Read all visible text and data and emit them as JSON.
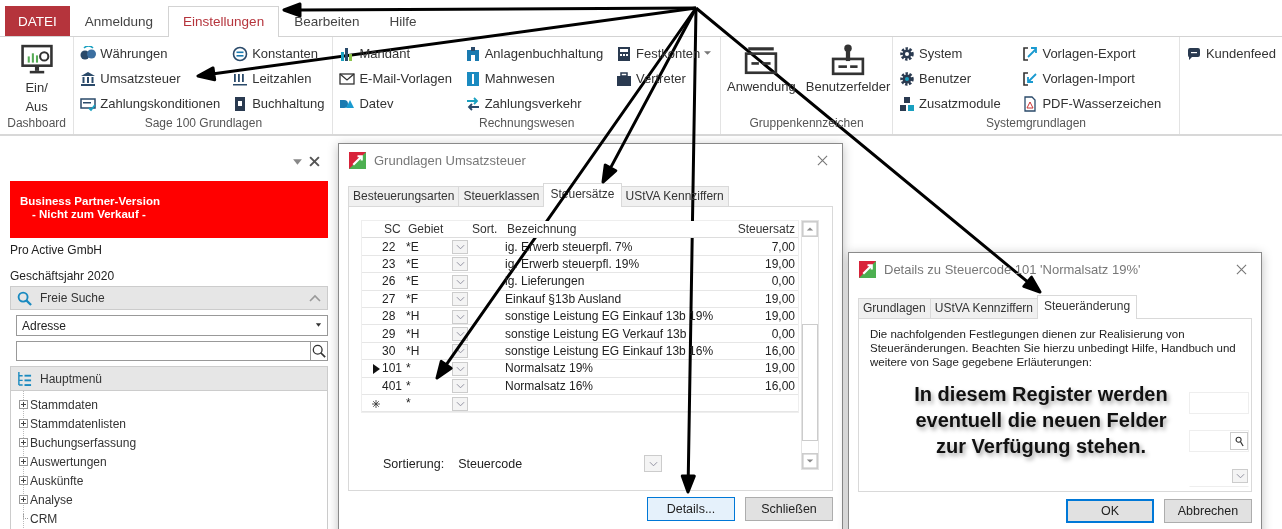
{
  "menu_tabs": [
    {
      "label": "DATEI",
      "kind": "file",
      "selected": false
    },
    {
      "label": "Anmeldung",
      "kind": "tab",
      "selected": false
    },
    {
      "label": "Einstellungen",
      "kind": "tab",
      "selected": true
    },
    {
      "label": "Bearbeiten",
      "kind": "tab",
      "selected": false
    },
    {
      "label": "Hilfe",
      "kind": "tab",
      "selected": false
    }
  ],
  "ribbon_groups": [
    {
      "label": "Dashboard",
      "items": [
        {
          "label": "Ein/ Aus",
          "kind": "large"
        }
      ]
    },
    {
      "label": "Sage 100 Grundlagen",
      "items": [
        {
          "label": "Währungen",
          "kind": "small"
        },
        {
          "label": "Umsatzsteuer",
          "kind": "small"
        },
        {
          "label": "Zahlungskonditionen",
          "kind": "small"
        },
        {
          "label": "Konstanten",
          "kind": "small"
        },
        {
          "label": "Leitzahlen",
          "kind": "small"
        },
        {
          "label": "Buchhaltung",
          "kind": "small"
        }
      ]
    },
    {
      "label": "Rechnungswesen",
      "items": [
        {
          "label": "Mandant",
          "kind": "small"
        },
        {
          "label": "E-Mail-Vorlagen",
          "kind": "small"
        },
        {
          "label": "Datev",
          "kind": "small"
        },
        {
          "label": "Anlagenbuchhaltung",
          "kind": "small"
        },
        {
          "label": "Mahnwesen",
          "kind": "small"
        },
        {
          "label": "Zahlungsverkehr",
          "kind": "small"
        },
        {
          "label": "Festkonten",
          "kind": "menu"
        },
        {
          "label": "Vertreter",
          "kind": "small"
        }
      ]
    },
    {
      "label": "Gruppenkennzeichen",
      "items": [
        {
          "label": "Anwendung",
          "kind": "large"
        },
        {
          "label": "Benutzerfelder",
          "kind": "large"
        }
      ]
    },
    {
      "label": "Systemgrundlagen",
      "items": [
        {
          "label": "System",
          "kind": "small"
        },
        {
          "label": "Benutzer",
          "kind": "small"
        },
        {
          "label": "Zusatzmodule",
          "kind": "small"
        },
        {
          "label": "Vorlagen-Export",
          "kind": "small"
        },
        {
          "label": "Vorlagen-Import",
          "kind": "small"
        },
        {
          "label": "PDF-Wasserzeichen",
          "kind": "small"
        }
      ]
    },
    {
      "items": [
        {
          "label": "Kundenfeed",
          "kind": "small"
        }
      ]
    }
  ],
  "sidebar": {
    "banner": [
      "Business Partner-Version",
      "- Nicht zum Verkauf -"
    ],
    "company": "Pro Active GmbH",
    "fiscal_year": "Geschäftsjahr 2020",
    "search_section": {
      "title": "Freie Suche",
      "expanded": true,
      "category": "Adresse"
    },
    "menu_title": "Hauptmenü",
    "tree": [
      {
        "label": "Stammdaten",
        "kind": "folder"
      },
      {
        "label": "Stammdatenlisten",
        "kind": "folder"
      },
      {
        "label": "Buchungserfassung",
        "kind": "folder"
      },
      {
        "label": "Auswertungen",
        "kind": "folder"
      },
      {
        "label": "Auskünfte",
        "kind": "folder"
      },
      {
        "label": "Analyse",
        "kind": "folder"
      },
      {
        "label": "CRM",
        "kind": "leaf"
      }
    ]
  },
  "tax_dialog": {
    "title": "Grundlagen Umsatzsteuer",
    "tabs": [
      {
        "label": "Besteuerungsarten",
        "selected": false
      },
      {
        "label": "Steuerklassen",
        "selected": false
      },
      {
        "label": "Steuersätze",
        "selected": true
      },
      {
        "label": "UStVA Kennziffern",
        "selected": false
      }
    ],
    "columns": [
      "SC",
      "Gebiet",
      "Sort.",
      "Bezeichnung",
      "Steuersatz"
    ],
    "rows": [
      {
        "kind": "entry",
        "selected": false,
        "sc": "22",
        "gebiet": "*E",
        "bezeichnung": "ig. Erwerb steuerpfl. 7%",
        "steuersatz": "7,00"
      },
      {
        "kind": "entry",
        "selected": false,
        "sc": "23",
        "gebiet": "*E",
        "bezeichnung": "ig. Erwerb steuerpfl. 19%",
        "steuersatz": "19,00"
      },
      {
        "kind": "entry",
        "selected": false,
        "sc": "26",
        "gebiet": "*E",
        "bezeichnung": "ig. Lieferungen",
        "steuersatz": "0,00"
      },
      {
        "kind": "entry",
        "selected": false,
        "sc": "27",
        "gebiet": "*F",
        "bezeichnung": "Einkauf §13b Ausland",
        "steuersatz": "19,00"
      },
      {
        "kind": "entry",
        "selected": false,
        "sc": "28",
        "gebiet": "*H",
        "bezeichnung": "sonstige Leistung EG Einkauf 13b 19%",
        "steuersatz": "19,00"
      },
      {
        "kind": "entry",
        "selected": false,
        "sc": "29",
        "gebiet": "*H",
        "bezeichnung": "sonstige Leistung EG Verkauf 13b",
        "steuersatz": "0,00"
      },
      {
        "kind": "entry",
        "selected": false,
        "sc": "30",
        "gebiet": "*H",
        "bezeichnung": "sonstige Leistung EG Einkauf 13b 16%",
        "steuersatz": "16,00"
      },
      {
        "kind": "entry",
        "selected": true,
        "sc": "101",
        "gebiet": "*",
        "bezeichnung": "Normalsatz 19%",
        "steuersatz": "19,00"
      },
      {
        "kind": "entry",
        "selected": false,
        "sc": "401",
        "gebiet": "*",
        "bezeichnung": "Normalsatz 16%",
        "steuersatz": "16,00"
      },
      {
        "kind": "new",
        "selected": false,
        "gebiet": "*"
      }
    ],
    "sort_label": "Sortierung:",
    "sort_value": "Steuercode",
    "buttons": [
      {
        "label": "Details...",
        "default": true
      },
      {
        "label": "Schließen",
        "default": false
      }
    ]
  },
  "details_dialog": {
    "title": "Details zu Steuercode 101 'Normalsatz 19%'",
    "tabs": [
      {
        "label": "Grundlagen",
        "selected": false
      },
      {
        "label": "UStVA Kennziffern",
        "selected": false
      },
      {
        "label": "Steueränderung",
        "selected": true
      }
    ],
    "description": "Die nachfolgenden Festlegungen dienen zur Realisierung von Steueränderungen. Beachten Sie hierzu unbedingt Hilfe, Handbuch und weitere von Sage gegebene Erläuterungen:",
    "note": "In diesem Register werden eventuell die neuen Felder zur Verfügung stehen.",
    "buttons": [
      {
        "label": "OK",
        "default": true
      },
      {
        "label": "Abbrechen",
        "default": false
      }
    ]
  }
}
